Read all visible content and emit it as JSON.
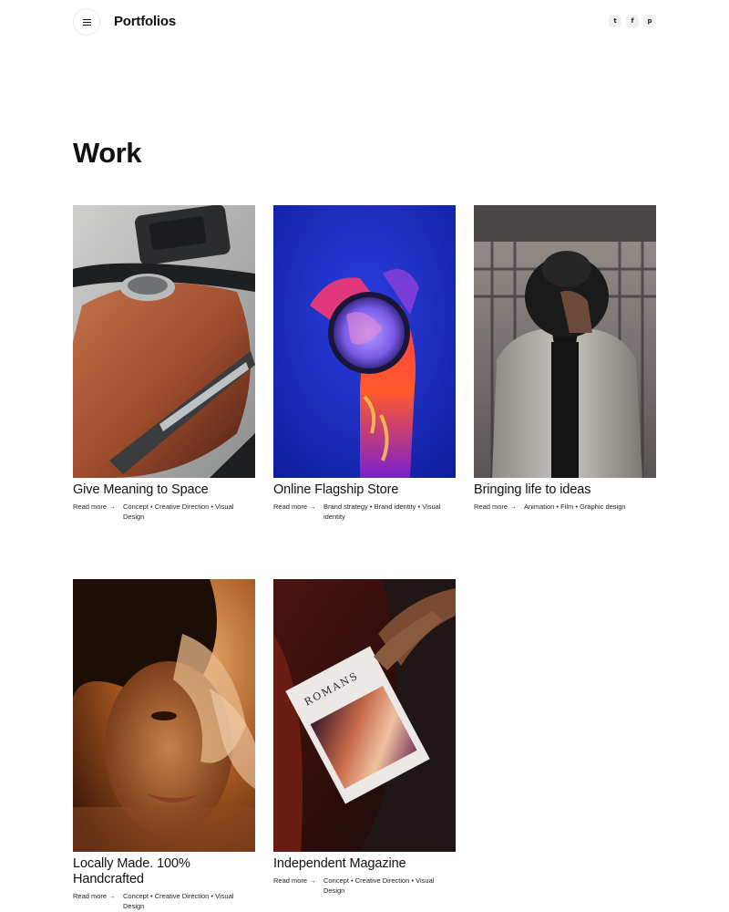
{
  "header": {
    "brand": "Portfolios",
    "social": [
      {
        "icon": "twitter-icon",
        "glyph": "t"
      },
      {
        "icon": "facebook-icon",
        "glyph": "f"
      },
      {
        "icon": "pinterest-icon",
        "glyph": "p"
      }
    ]
  },
  "page": {
    "title": "Work"
  },
  "works": [
    {
      "title": "Give Meaning to Space",
      "read_more": "Read more →",
      "tags": "Concept • Creative Direction • Visual Design"
    },
    {
      "title": "Online Flagship Store",
      "read_more": "Read more →",
      "tags": "Brand strategy • Brand identity • Visual identity"
    },
    {
      "title": "Bringing life to ideas",
      "read_more": "Read more →",
      "tags": "Animation • Film • Graphic design"
    },
    {
      "title": "Locally Made. 100% Handcrafted",
      "read_more": "Read more →",
      "tags": "Concept • Creative Direction • Visual Design"
    },
    {
      "title": "Independent Magazine",
      "read_more": "Read more →",
      "tags": "Concept • Creative Direction • Visual Design"
    }
  ],
  "magazine_cover_text": "ROMANS"
}
